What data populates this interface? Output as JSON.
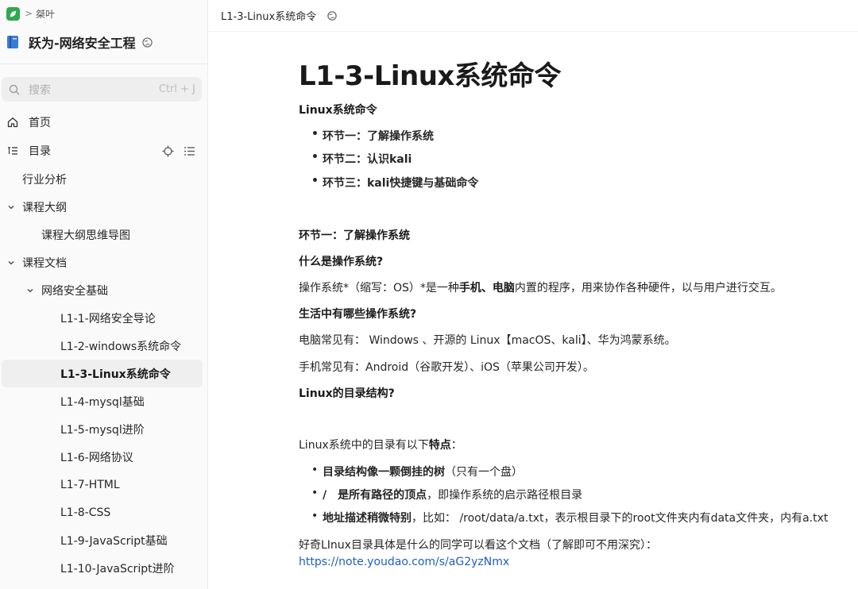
{
  "breadcrumb": {
    "separator": ">",
    "space": "桀叶"
  },
  "knowledge_base": {
    "title": "跃为-网络安全工程"
  },
  "search": {
    "placeholder": "搜索",
    "shortcut": "Ctrl + J"
  },
  "nav": {
    "home": "首页",
    "toc": "目录"
  },
  "tree": [
    {
      "label": "行业分析",
      "level": 0,
      "caret": "none",
      "active": false
    },
    {
      "label": "课程大纲",
      "level": 0,
      "caret": "down",
      "active": false
    },
    {
      "label": "课程大纲思维导图",
      "level": 1,
      "caret": "none",
      "active": false
    },
    {
      "label": "课程文档",
      "level": 0,
      "caret": "down",
      "active": false
    },
    {
      "label": "网络安全基础",
      "level": 1,
      "caret": "down",
      "active": false
    },
    {
      "label": "L1-1-网络安全导论",
      "level": 2,
      "caret": "none",
      "active": false
    },
    {
      "label": "L1-2-windows系统命令",
      "level": 2,
      "caret": "none",
      "active": false
    },
    {
      "label": "L1-3-Linux系统命令",
      "level": 2,
      "caret": "none",
      "active": true
    },
    {
      "label": "L1-4-mysql基础",
      "level": 2,
      "caret": "none",
      "active": false
    },
    {
      "label": "L1-5-mysql进阶",
      "level": 2,
      "caret": "none",
      "active": false
    },
    {
      "label": "L1-6-网络协议",
      "level": 2,
      "caret": "none",
      "active": false
    },
    {
      "label": "L1-7-HTML",
      "level": 2,
      "caret": "none",
      "active": false
    },
    {
      "label": "L1-8-CSS",
      "level": 2,
      "caret": "none",
      "active": false
    },
    {
      "label": "L1-9-JavaScript基础",
      "level": 2,
      "caret": "none",
      "active": false
    },
    {
      "label": "L1-10-JavaScript进阶",
      "level": 2,
      "caret": "none",
      "active": false
    }
  ],
  "topbar": {
    "doc_name": "L1-3-Linux系统命令"
  },
  "document": {
    "title": "L1-3-Linux系统命令",
    "intro_heading": "Linux系统命令",
    "sections_list": [
      "环节一：了解操作系统",
      "环节二：认识kali",
      "环节三：kali快捷键与基础命令"
    ],
    "section1_heading": "环节一：了解操作系统",
    "q1": "什么是操作系统?",
    "def_a": "操作系统*（缩写：OS）*是一种",
    "def_b": "手机、电脑",
    "def_c": "内置的程序，用来协作各种硬件，以与用户进行交互。",
    "q2": "生活中有哪些操作系统?",
    "pc_os": "电脑常见有： Windows 、开源的 Linux【macOS、kali】、华为鸿蒙系统。",
    "phone_os": "手机常见有：Android（谷歌开发）、iOS（苹果公司开发）。",
    "q3": "Linux的目录结构?",
    "features_a": "Linux系统中的目录有以下",
    "features_b": "特点",
    "features_c": "：",
    "f1_bold": "目录结构像一颗倒挂的树",
    "f1_rest": "（只有一个盘）",
    "f2_bold": "/　是所有路径的顶点",
    "f2_rest": "，即操作系统的启示路径根目录",
    "f3_bold": "地址描述稍微特别",
    "f3_rest": "，比如： /root/data/a.txt，表示根目录下的root文件夹内有data文件夹，内有a.txt",
    "curious": "好奇LInux目录具体是什么的同学可以看这个文档（了解即可不用深究）：",
    "link": "https://note.youdao.com/s/aG2yzNmx"
  },
  "colors": {
    "logo_green": "#2fa84f",
    "active_bg": "#efefef",
    "link": "#1f5fbf"
  }
}
